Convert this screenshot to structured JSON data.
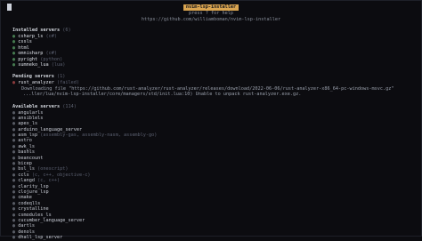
{
  "header": {
    "title": "nvim-lsp-installer",
    "help": "press ? for help",
    "url": "https://github.com/williamboman/nvim-lsp-installer"
  },
  "installed": {
    "heading": "Installed servers",
    "count": "(6)",
    "items": [
      {
        "name": "csharp_ls",
        "lang": "(c#)"
      },
      {
        "name": "cssls",
        "lang": ""
      },
      {
        "name": "html",
        "lang": ""
      },
      {
        "name": "omnisharp",
        "lang": "(c#)"
      },
      {
        "name": "pyright",
        "lang": "(python)"
      },
      {
        "name": "sumneko_lua",
        "lang": "(lua)"
      }
    ]
  },
  "pending": {
    "heading": "Pending servers",
    "count": "(1)",
    "items": [
      {
        "name": "rust_analyzer",
        "status": "(failed)",
        "log1": "Downloading file \"https://github.com/rust-analyzer/rust-analyzer/releases/download/2022-06-06/rust-analyzer-x86_64-pc-windows-msvc.gz\"",
        "log2": "...ller/lua/nvim-lsp-installer/core/managers/std/init.lua:10) Unable to unpack rust-analyzer.exe.gz."
      }
    ]
  },
  "available": {
    "heading": "Available servers",
    "count": "(114)",
    "items": [
      {
        "name": "angularls",
        "lang": ""
      },
      {
        "name": "ansiblels",
        "lang": ""
      },
      {
        "name": "apex_ls",
        "lang": ""
      },
      {
        "name": "arduino_language_server",
        "lang": ""
      },
      {
        "name": "asm_lsp",
        "lang": "(assembly-gas, assembly-nasm, assembly-go)"
      },
      {
        "name": "astro",
        "lang": ""
      },
      {
        "name": "awk_ls",
        "lang": ""
      },
      {
        "name": "bashls",
        "lang": ""
      },
      {
        "name": "beancount",
        "lang": ""
      },
      {
        "name": "bicep",
        "lang": ""
      },
      {
        "name": "bsl_ls",
        "lang": "(onescript)"
      },
      {
        "name": "ccls",
        "lang": "(c, c++, objective-c)"
      },
      {
        "name": "clangd",
        "lang": "(c, c++)"
      },
      {
        "name": "clarity_lsp",
        "lang": ""
      },
      {
        "name": "clojure_lsp",
        "lang": ""
      },
      {
        "name": "cmake",
        "lang": ""
      },
      {
        "name": "codeqlls",
        "lang": ""
      },
      {
        "name": "crystalline",
        "lang": ""
      },
      {
        "name": "csmodules_ls",
        "lang": ""
      },
      {
        "name": "cucumber_language_server",
        "lang": ""
      },
      {
        "name": "dartls",
        "lang": ""
      },
      {
        "name": "denols",
        "lang": ""
      },
      {
        "name": "dhall_lsp_server",
        "lang": ""
      }
    ]
  },
  "icons": {
    "installed_bullet": "check-circle-icon",
    "failed_bullet": "error-circle-icon",
    "available_bullet": "empty-circle-icon"
  },
  "colors": {
    "background": "#0c0c10",
    "title_bg": "#d9a450",
    "installed": "#6cc27a",
    "failed": "#e05a5a"
  }
}
